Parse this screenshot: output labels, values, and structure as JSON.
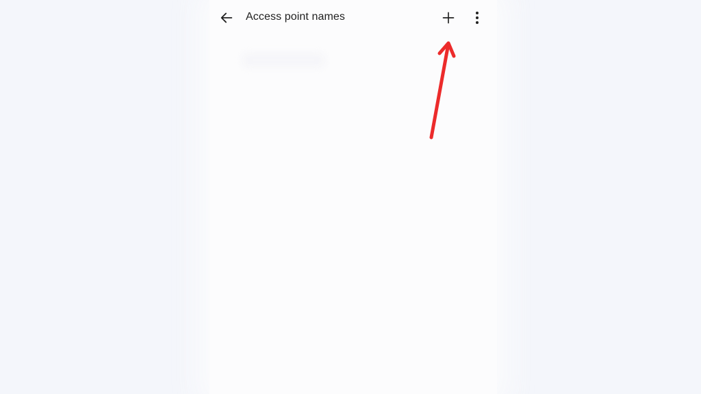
{
  "app_bar": {
    "title": "Access point names",
    "back_icon": "arrow-left-icon",
    "add_icon": "plus-icon",
    "more_icon": "more-vert-icon"
  },
  "colors": {
    "background": "#f4f6fb",
    "screen": "#fcfcfd",
    "text": "#1f1f1f",
    "annotation_arrow": "#ec2b2b"
  }
}
